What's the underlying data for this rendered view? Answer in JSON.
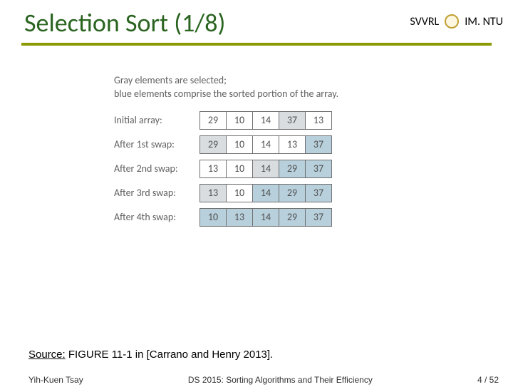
{
  "header": {
    "org_left": "SVVRL",
    "org_right": "IM. NTU"
  },
  "title": "Selection Sort (1/8)",
  "legend": {
    "line1": "Gray elements are selected;",
    "line2": "blue elements comprise the sorted portion of the array."
  },
  "chart_data": {
    "type": "table",
    "rows": [
      {
        "label": "Initial array:",
        "cells": [
          {
            "v": "29",
            "c": "w"
          },
          {
            "v": "10",
            "c": "w"
          },
          {
            "v": "14",
            "c": "w"
          },
          {
            "v": "37",
            "c": "g"
          },
          {
            "v": "13",
            "c": "w"
          }
        ]
      },
      {
        "label": "After 1st swap:",
        "cells": [
          {
            "v": "29",
            "c": "g"
          },
          {
            "v": "10",
            "c": "w"
          },
          {
            "v": "14",
            "c": "w"
          },
          {
            "v": "13",
            "c": "w"
          },
          {
            "v": "37",
            "c": "b"
          }
        ]
      },
      {
        "label": "After 2nd swap:",
        "cells": [
          {
            "v": "13",
            "c": "w"
          },
          {
            "v": "10",
            "c": "w"
          },
          {
            "v": "14",
            "c": "g"
          },
          {
            "v": "29",
            "c": "b"
          },
          {
            "v": "37",
            "c": "b"
          }
        ]
      },
      {
        "label": "After 3rd swap:",
        "cells": [
          {
            "v": "13",
            "c": "g"
          },
          {
            "v": "10",
            "c": "w"
          },
          {
            "v": "14",
            "c": "b"
          },
          {
            "v": "29",
            "c": "b"
          },
          {
            "v": "37",
            "c": "b"
          }
        ]
      },
      {
        "label": "After 4th swap:",
        "cells": [
          {
            "v": "10",
            "c": "b"
          },
          {
            "v": "13",
            "c": "b"
          },
          {
            "v": "14",
            "c": "b"
          },
          {
            "v": "29",
            "c": "b"
          },
          {
            "v": "37",
            "c": "b"
          }
        ]
      }
    ]
  },
  "source": {
    "label": "Source:",
    "text": " FIGURE 11-1 in [Carrano and Henry 2013]."
  },
  "footer": {
    "author": "Yih-Kuen Tsay",
    "course": "DS 2015: Sorting Algorithms and Their Efficiency",
    "page": "4 / 52"
  }
}
